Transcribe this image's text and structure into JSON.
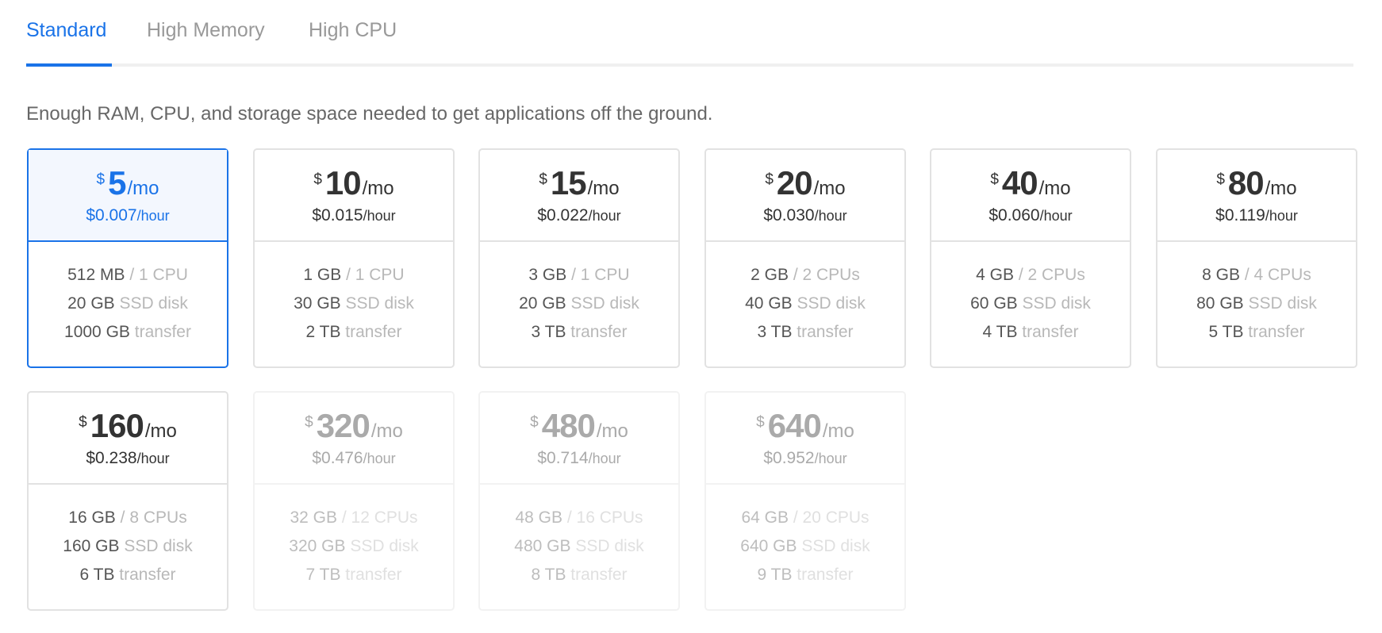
{
  "tabs": [
    {
      "label": "Standard",
      "active": true
    },
    {
      "label": "High Memory",
      "active": false
    },
    {
      "label": "High CPU",
      "active": false
    }
  ],
  "description": "Enough RAM, CPU, and storage space needed to get applications off the ground.",
  "colors": {
    "accent": "#1a73e8",
    "text": "#333333",
    "muted": "#b8b8b8",
    "border": "#e2e2e2"
  },
  "currency_symbol": "$",
  "per_month_label": "/mo",
  "per_hour_label": "/hour",
  "plans": [
    {
      "monthly": "5",
      "hourly": "$0.007",
      "memory": "512 MB",
      "cpus": "/ 1 CPU",
      "disk": "20 GB",
      "disk_label": "SSD disk",
      "transfer": "1000 GB",
      "transfer_label": "transfer",
      "state": "selected"
    },
    {
      "monthly": "10",
      "hourly": "$0.015",
      "memory": "1 GB",
      "cpus": "/ 1 CPU",
      "disk": "30 GB",
      "disk_label": "SSD disk",
      "transfer": "2 TB",
      "transfer_label": "transfer",
      "state": "available"
    },
    {
      "monthly": "15",
      "hourly": "$0.022",
      "memory": "3 GB",
      "cpus": "/ 1 CPU",
      "disk": "20 GB",
      "disk_label": "SSD disk",
      "transfer": "3 TB",
      "transfer_label": "transfer",
      "state": "available"
    },
    {
      "monthly": "20",
      "hourly": "$0.030",
      "memory": "2 GB",
      "cpus": "/ 2 CPUs",
      "disk": "40 GB",
      "disk_label": "SSD disk",
      "transfer": "3 TB",
      "transfer_label": "transfer",
      "state": "available"
    },
    {
      "monthly": "40",
      "hourly": "$0.060",
      "memory": "4 GB",
      "cpus": "/ 2 CPUs",
      "disk": "60 GB",
      "disk_label": "SSD disk",
      "transfer": "4 TB",
      "transfer_label": "transfer",
      "state": "available"
    },
    {
      "monthly": "80",
      "hourly": "$0.119",
      "memory": "8 GB",
      "cpus": "/ 4 CPUs",
      "disk": "80 GB",
      "disk_label": "SSD disk",
      "transfer": "5 TB",
      "transfer_label": "transfer",
      "state": "available"
    },
    {
      "monthly": "160",
      "hourly": "$0.238",
      "memory": "16 GB",
      "cpus": "/ 8 CPUs",
      "disk": "160 GB",
      "disk_label": "SSD disk",
      "transfer": "6 TB",
      "transfer_label": "transfer",
      "state": "available"
    },
    {
      "monthly": "320",
      "hourly": "$0.476",
      "memory": "32 GB",
      "cpus": "/ 12 CPUs",
      "disk": "320 GB",
      "disk_label": "SSD disk",
      "transfer": "7 TB",
      "transfer_label": "transfer",
      "state": "disabled"
    },
    {
      "monthly": "480",
      "hourly": "$0.714",
      "memory": "48 GB",
      "cpus": "/ 16 CPUs",
      "disk": "480 GB",
      "disk_label": "SSD disk",
      "transfer": "8 TB",
      "transfer_label": "transfer",
      "state": "disabled"
    },
    {
      "monthly": "640",
      "hourly": "$0.952",
      "memory": "64 GB",
      "cpus": "/ 20 CPUs",
      "disk": "640 GB",
      "disk_label": "SSD disk",
      "transfer": "9 TB",
      "transfer_label": "transfer",
      "state": "disabled"
    }
  ]
}
